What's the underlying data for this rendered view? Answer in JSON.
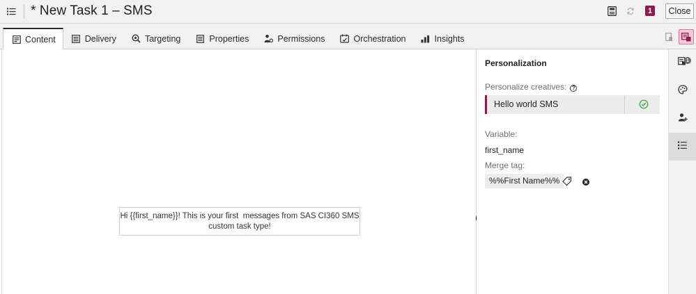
{
  "window": {
    "title": "* New Task 1 – SMS",
    "badge_count": "1",
    "close_label": "Close"
  },
  "tabs": [
    {
      "label": "Content",
      "icon": "content-icon",
      "active": true
    },
    {
      "label": "Delivery",
      "icon": "delivery-icon"
    },
    {
      "label": "Targeting",
      "icon": "targeting-icon"
    },
    {
      "label": "Properties",
      "icon": "properties-icon"
    },
    {
      "label": "Permissions",
      "icon": "permissions-icon"
    },
    {
      "label": "Orchestration",
      "icon": "orchestration-icon"
    },
    {
      "label": "Insights",
      "icon": "insights-icon"
    }
  ],
  "preview": {
    "message_line1": "Hi {{first_name}}! This is your first  messages from SAS CI360 SMS",
    "message_line2": "custom task type!"
  },
  "personalization": {
    "title": "Personalization",
    "creatives_label": "Personalize creatives:",
    "creative_name": "Hello world SMS",
    "variable_label": "Variable:",
    "variable_value": "first_name",
    "merge_tag_label": "Merge tag:",
    "merge_tag_value": "%%First Name%%"
  },
  "rail": {
    "badge_count": "1"
  },
  "colors": {
    "accent": "#8c1c4d",
    "accent_light": "#f3c9d6",
    "success": "#3a9a3a"
  }
}
